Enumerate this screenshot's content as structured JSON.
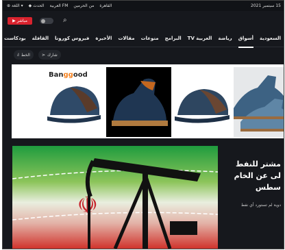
{
  "topbar": {
    "date": "15 سبتمبر 2021",
    "links": [
      "القاهرة",
      "من الحرمين",
      "العربية FM",
      "الحدث"
    ],
    "lang_label": "اللغة"
  },
  "header": {
    "live_label": "مباشر",
    "toggle_label": "0"
  },
  "nav": {
    "items": [
      "السعودية",
      "أسواق",
      "رياضة",
      "العربية TV",
      "البرامج",
      "منوعات",
      "مقالات",
      "الأخيرة",
      "فيروس كورونا",
      "القافلة",
      "بودكاست"
    ],
    "active_index": 1
  },
  "tools": {
    "share_label": "شارك",
    "font_label": "الخط"
  },
  "ad": {
    "brand_prefix": "Ban",
    "brand_highlight": "gg",
    "brand_suffix": "ood"
  },
  "article": {
    "headline_lines": [
      "مشتر للنفط",
      "لى عن الخام",
      "سطس"
    ],
    "subtitle": "دوية لم تستورد أي نفط"
  },
  "colors": {
    "background": "#16181d",
    "live_red": "#d9232e",
    "brand_orange": "#f58220"
  }
}
